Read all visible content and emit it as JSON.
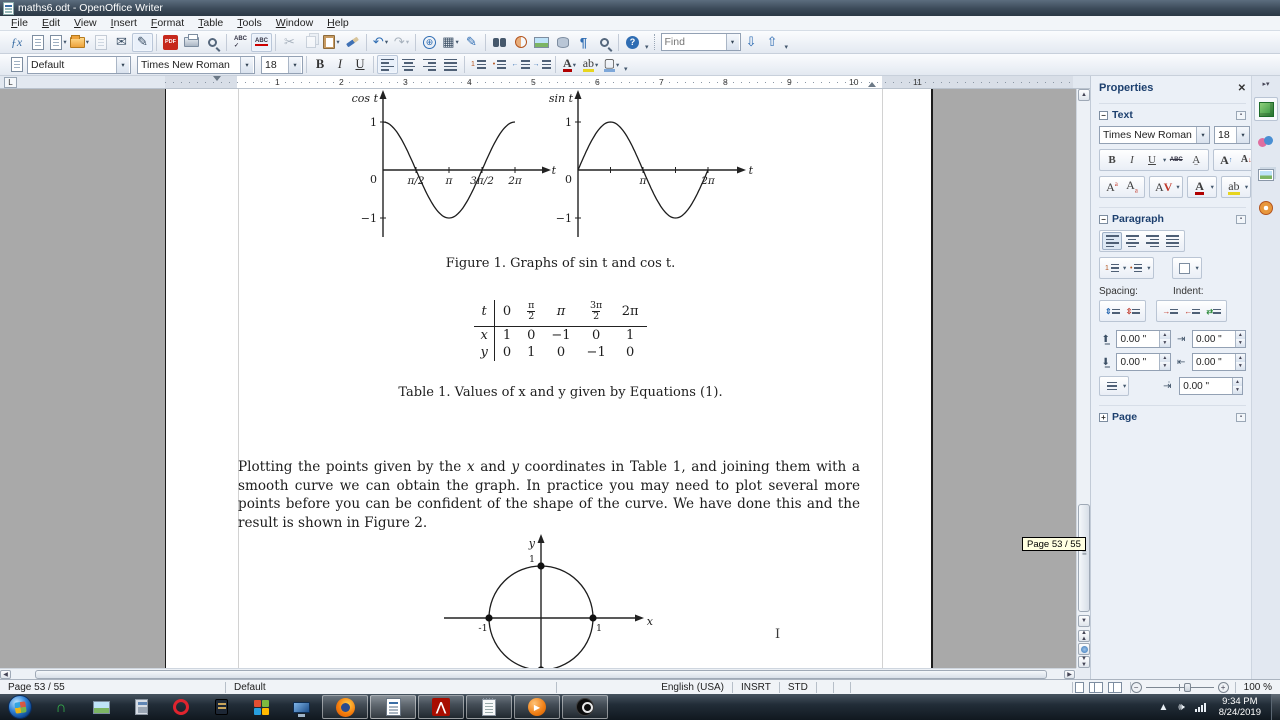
{
  "titlebar": {
    "title": "maths6.odt - OpenOffice Writer"
  },
  "menus": [
    "File",
    "Edit",
    "View",
    "Insert",
    "Format",
    "Table",
    "Tools",
    "Window",
    "Help"
  ],
  "toolbar": {
    "find_placeholder": "Find"
  },
  "formatting": {
    "style": "Default",
    "font": "Times New Roman",
    "size": "18",
    "bold": "B",
    "italic": "I",
    "underline": "U"
  },
  "ruler_numbers": [
    "1",
    "2",
    "3",
    "4",
    "5",
    "6",
    "7",
    "8",
    "9",
    "10",
    "11"
  ],
  "doc": {
    "fig1": {
      "cos": {
        "title": "cos t",
        "one": "1",
        "minus_one": "−1",
        "zero": "0",
        "t1": "π/2",
        "t2": "π",
        "t3": "3π/2",
        "t4": "2π",
        "axis": "t"
      },
      "sin": {
        "title": "sin t",
        "one": "1",
        "minus_one": "−1",
        "zero": "0",
        "t2": "π",
        "t4": "2π",
        "axis": "t"
      },
      "caption": "Figure 1. Graphs of sin t and cos t."
    },
    "table1": {
      "corner": "t",
      "h1": "0",
      "h2n": "π",
      "h2d": "2",
      "h3": "π",
      "h4n": "3π",
      "h4d": "2",
      "h5": "2π",
      "rx": [
        "x",
        "1",
        "0",
        "−1",
        "0",
        "1"
      ],
      "ry": [
        "y",
        "0",
        "1",
        "0",
        "−1",
        "0"
      ],
      "caption": "Table 1. Values of x and y given by Equations (1)."
    },
    "para": {
      "s1": "Plotting the points given by the ",
      "s2": "x",
      "s3": " and ",
      "s4": "y",
      "s5": " coordinates in Table 1, and joining them with a smooth curve we can obtain the graph. In practice you may need to plot several more points before you can be confident of the shape of the curve. We have done this and the result is shown in Figure 2."
    },
    "fig2": {
      "ylabel": "y",
      "xlabel": "x",
      "top": "1",
      "left": "-1",
      "right": "1"
    }
  },
  "scroll_tooltip": "Page 53 / 55",
  "sidebar": {
    "title": "Properties",
    "text_section": {
      "header": "Text",
      "font": "Times New Roman",
      "size": "18"
    },
    "paragraph_section": {
      "header": "Paragraph",
      "spacing_label": "Spacing:",
      "indent_label": "Indent:",
      "spacing_above": "0.00 \"",
      "spacing_below": "0.00 \"",
      "indent_before": "0.00 \"",
      "indent_after": "0.00 \"",
      "indent_first": "0.00 \""
    },
    "page_section": {
      "header": "Page"
    }
  },
  "statusbar": {
    "page": "Page 53 / 55",
    "style": "Default",
    "language": "English (USA)",
    "insert_mode": "INSRT",
    "selection_mode": "STD",
    "zoom": "100 %"
  },
  "tray": {
    "time": "9:34 PM",
    "date": "8/24/2019"
  },
  "colors": {
    "doc_background": "#a9a9a9",
    "tooltip": "#ffffe1",
    "taskbar": "#1c2630",
    "titlebar": "#3b4a59"
  }
}
